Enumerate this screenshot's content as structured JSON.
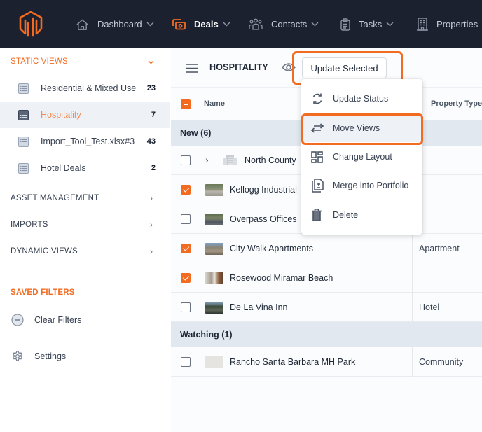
{
  "colors": {
    "accent": "#f36b21",
    "topbar_bg": "#1c2130",
    "group_row_bg": "#e2e8f0",
    "active_sidebar_bg": "#eef1f5"
  },
  "topnav": {
    "logo": "brand-logo",
    "items": [
      {
        "label": "Dashboard",
        "icon": "home-icon",
        "active": false
      },
      {
        "label": "Deals",
        "icon": "deals-icon",
        "active": true
      },
      {
        "label": "Contacts",
        "icon": "contacts-icon",
        "active": false
      },
      {
        "label": "Tasks",
        "icon": "clipboard-icon",
        "active": false
      },
      {
        "label": "Properties",
        "icon": "building-icon",
        "active": false
      }
    ]
  },
  "sidebar": {
    "static_views": {
      "title": "STATIC VIEWS",
      "expanded": true,
      "items": [
        {
          "label": "Residential & Mixed Use",
          "count": "23",
          "active": false
        },
        {
          "label": "Hospitality",
          "count": "7",
          "active": true
        },
        {
          "label": "Import_Tool_Test.xlsx#3",
          "count": "43",
          "active": false
        },
        {
          "label": "Hotel Deals",
          "count": "2",
          "active": false
        }
      ]
    },
    "sections": [
      {
        "label": "ASSET MANAGEMENT"
      },
      {
        "label": "IMPORTS"
      },
      {
        "label": "DYNAMIC VIEWS"
      }
    ],
    "saved_filters": {
      "title": "SAVED FILTERS",
      "clear_label": "Clear Filters"
    },
    "settings_label": "Settings"
  },
  "toolbar": {
    "view_title": "HOSPITALITY",
    "update_selected_label": "Update Selected"
  },
  "table": {
    "columns": {
      "name": "Name",
      "property_type": "Property Type"
    },
    "groups": [
      {
        "label": "New (6)",
        "rows": [
          {
            "name": "North County",
            "property_type": "",
            "checked": false,
            "expandable": true,
            "thumb": "building-placeholder"
          },
          {
            "name": "Kellogg Industrial",
            "property_type": "",
            "checked": true,
            "thumb": "photo"
          },
          {
            "name": "Overpass Offices",
            "property_type": "",
            "checked": false,
            "thumb": "photo"
          },
          {
            "name": "City Walk Apartments",
            "property_type": "Apartment",
            "checked": true,
            "thumb": "photo"
          },
          {
            "name": "Rosewood Miramar Beach",
            "property_type": "",
            "checked": true,
            "thumb": "photo"
          },
          {
            "name": "De La Vina Inn",
            "property_type": "Hotel",
            "checked": false,
            "thumb": "photo"
          }
        ]
      },
      {
        "label": "Watching (1)",
        "rows": [
          {
            "name": "Rancho Santa Barbara MH Park",
            "property_type": "Community",
            "checked": false,
            "thumb": "blank"
          }
        ]
      }
    ]
  },
  "update_menu": {
    "items": [
      {
        "label": "Update Status",
        "icon": "refresh-icon"
      },
      {
        "label": "Move Views",
        "icon": "swap-arrows-icon",
        "highlighted": true
      },
      {
        "label": "Change Layout",
        "icon": "layout-icon"
      },
      {
        "label": "Merge into Portfolio",
        "icon": "merge-document-icon"
      },
      {
        "label": "Delete",
        "icon": "trash-icon"
      }
    ]
  }
}
